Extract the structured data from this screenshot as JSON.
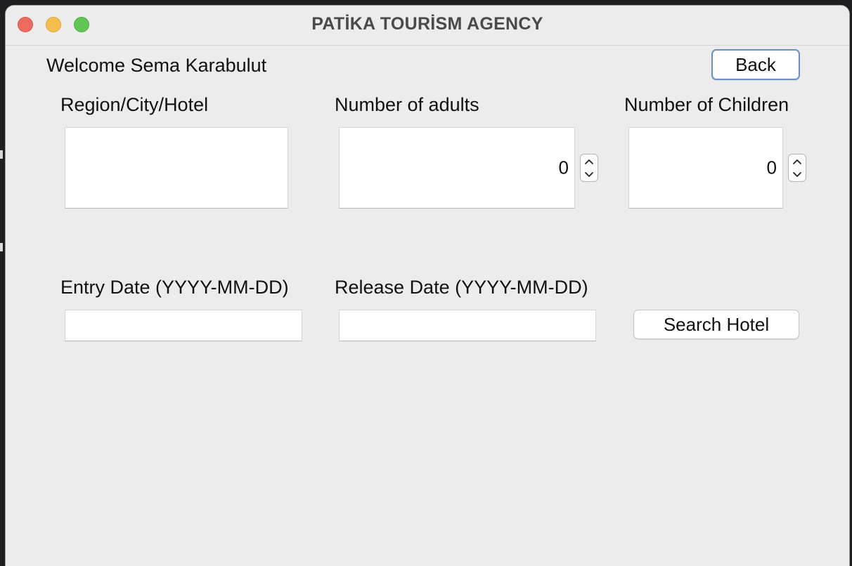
{
  "window": {
    "title": "PATİKA TOURİSM AGENCY"
  },
  "header": {
    "welcome_text": "Welcome Sema Karabulut",
    "back_label": "Back"
  },
  "search_form": {
    "region_label": "Region/City/Hotel",
    "region_value": "",
    "adults_label": "Number of adults",
    "adults_value": "0",
    "children_label": "Number of Children",
    "children_value": "0",
    "entry_date_label": "Entry Date (YYYY-MM-DD)",
    "entry_date_value": "",
    "release_date_label": "Release Date (YYYY-MM-DD)",
    "release_date_value": "",
    "search_label": "Search Hotel"
  },
  "icons": {
    "traffic_lights": [
      "close-icon",
      "minimize-icon",
      "zoom-icon"
    ],
    "stepper": [
      "chevron-up-icon",
      "chevron-down-icon"
    ]
  },
  "colors": {
    "window_bg": "#ececec",
    "close": "#ed6a5e",
    "minimize": "#f5bf4f",
    "zoom": "#61c554",
    "focus_ring": "#6b8fbf"
  }
}
